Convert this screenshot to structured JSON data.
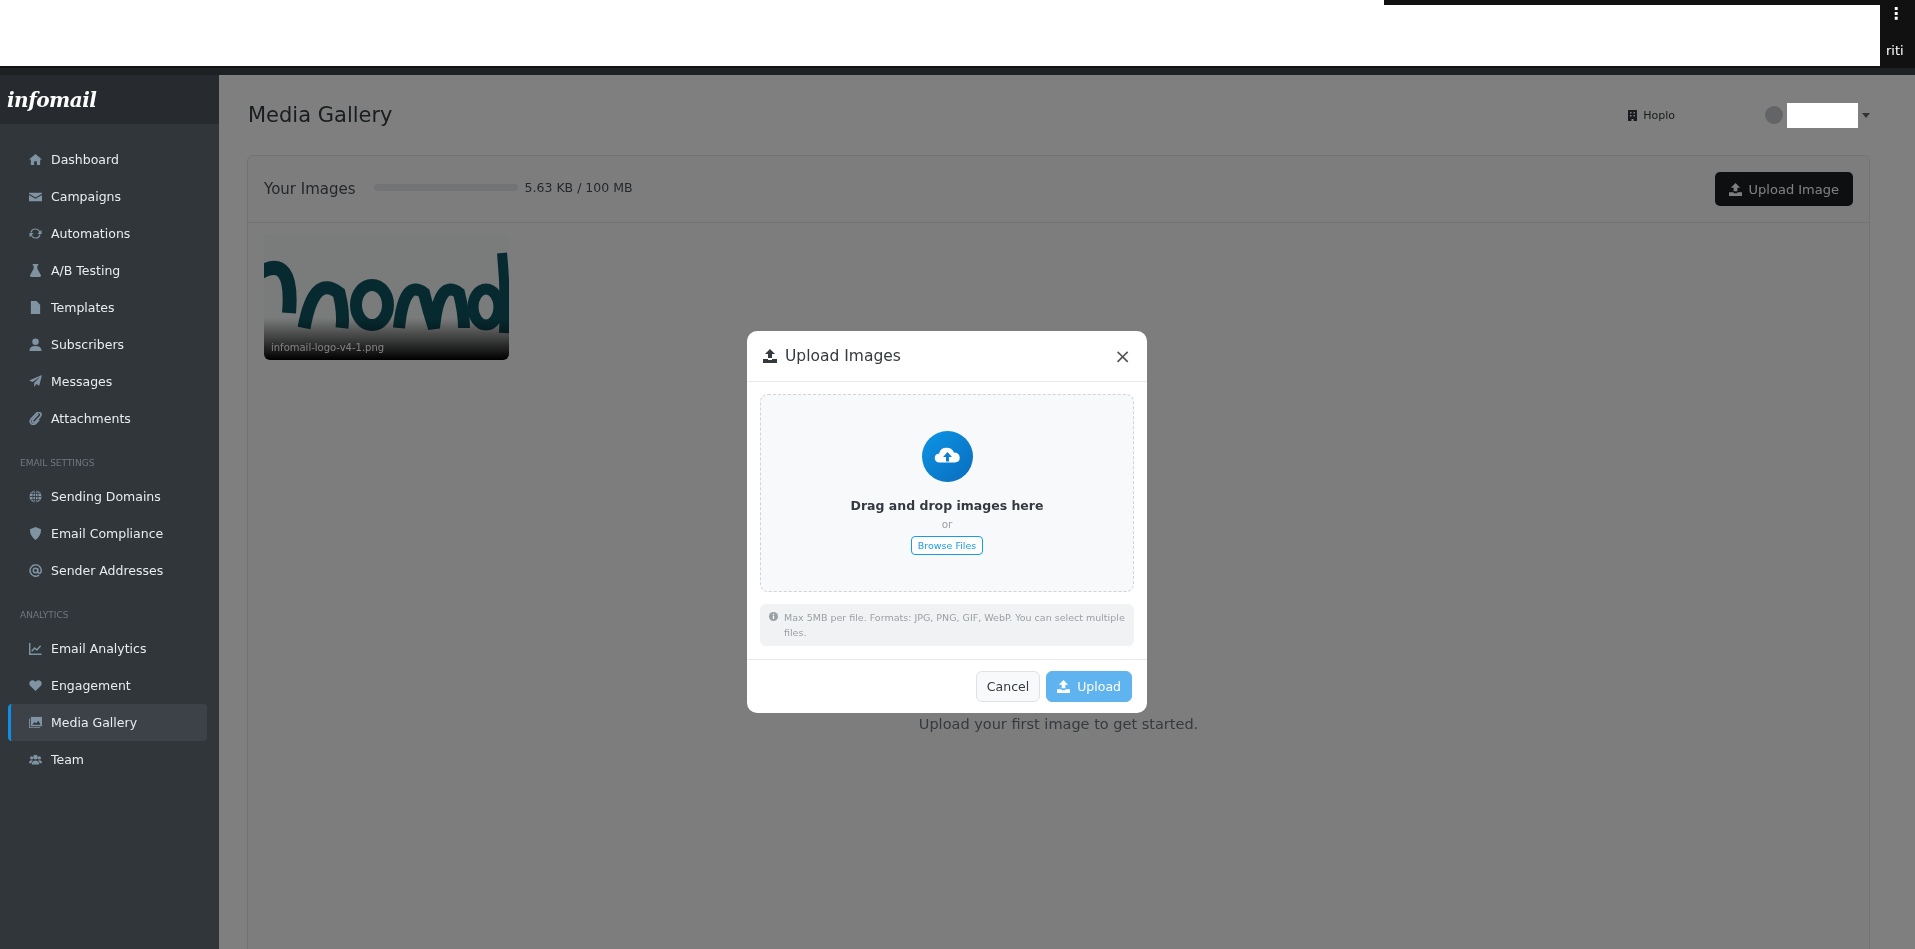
{
  "browser_strip": {
    "menu_glyph": "⋮",
    "clipped_text": "riti"
  },
  "sidebar": {
    "logo": "infomail",
    "sections": [
      {
        "items": [
          {
            "label": "Dashboard",
            "selected": false
          },
          {
            "label": "Campaigns",
            "selected": false
          },
          {
            "label": "Automations",
            "selected": false
          },
          {
            "label": "A/B Testing",
            "selected": false
          },
          {
            "label": "Templates",
            "selected": false
          },
          {
            "label": "Subscribers",
            "selected": false
          },
          {
            "label": "Messages",
            "selected": false
          },
          {
            "label": "Attachments",
            "selected": false
          }
        ]
      },
      {
        "heading": "EMAIL SETTINGS",
        "items": [
          {
            "label": "Sending Domains",
            "selected": false
          },
          {
            "label": "Email Compliance",
            "selected": false
          },
          {
            "label": "Sender Addresses",
            "selected": false
          }
        ]
      },
      {
        "heading": "ANALYTICS",
        "items": [
          {
            "label": "Email Analytics",
            "selected": false
          },
          {
            "label": "Engagement",
            "selected": false
          },
          {
            "label": "Media Gallery",
            "selected": true
          },
          {
            "label": "Team",
            "selected": false
          }
        ]
      }
    ]
  },
  "header": {
    "title": "Media Gallery",
    "organization": "Hoplo"
  },
  "gallery": {
    "heading": "Your Images",
    "storage": {
      "level": 0.0,
      "reading": "5.63 KB / 100 MB"
    },
    "upload_button": "Upload Image",
    "images": [
      {
        "kind": "picture",
        "filename": "infomail-logo-v4-1.png"
      }
    ],
    "empty_hint": "Upload your first image to get started."
  },
  "modal": {
    "title": "Upload Images",
    "close": "×",
    "dropzone": {
      "heading": "Drag and drop images here",
      "separator": "or",
      "browse_button": "Browse Files"
    },
    "info": "Max 5MB per file. Formats: JPG, PNG, GIF, WebP. You can select multiple files.",
    "buttons": [
      {
        "label": "Cancel",
        "kind": "secondary",
        "disabled": false
      },
      {
        "label": "Upload",
        "kind": "primary",
        "disabled": true
      }
    ]
  }
}
